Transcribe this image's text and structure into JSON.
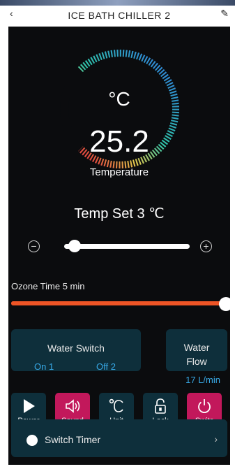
{
  "app": {
    "title": "ICE BATH CHILLER 2"
  },
  "nav": {
    "back_icon": "‹",
    "edit_icon": "✎"
  },
  "gauge": {
    "unit": "°C",
    "value": "25.2",
    "label": "Temperature"
  },
  "temp_set": {
    "label": "Temp Set",
    "value": "3",
    "unit": "℃"
  },
  "temp_set_display": "Temp Set  3  ℃",
  "controls": {
    "minus_symbol": "−",
    "plus_symbol": "+"
  },
  "ozone": {
    "label": "Ozone Time 5 min",
    "level": 1.0
  },
  "water_switch": {
    "title": "Water Switch",
    "on": "On 1",
    "off": "Off 2"
  },
  "water_flow": {
    "title": "Water\nFlow",
    "value": "17 L/min"
  },
  "buttons": [
    {
      "label": "Power",
      "icon": "play-icon",
      "active": false
    },
    {
      "label": "Sound",
      "icon": "speaker-icon",
      "active": true
    },
    {
      "label": "Unit",
      "icon": "celsius-icon",
      "active": false
    },
    {
      "label": "Lock",
      "icon": "lock-icon",
      "active": false
    },
    {
      "label": "Switc",
      "icon": "power-icon",
      "active": true
    }
  ],
  "timer": {
    "label": "Switch Timer",
    "chevron": "›"
  },
  "colors": {
    "panel": "#0b0c0e",
    "card": "#0e2f3b",
    "accent_blue": "#38a9e6",
    "accent_orange": "#ee5526",
    "active_red": "#c2185b"
  }
}
